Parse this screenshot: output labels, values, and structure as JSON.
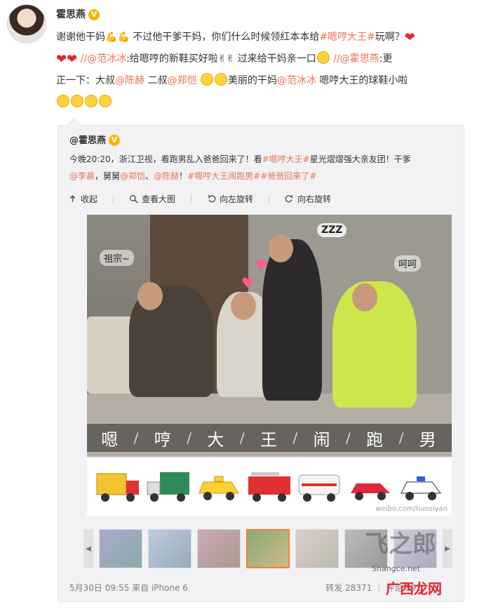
{
  "header": {
    "username": "霍思燕",
    "vip_badge": "V"
  },
  "post": {
    "line1_a": "谢谢他干妈",
    "line1_b": "不过他干爹干妈，你们什么时候领红本本给",
    "tag_hengheng": "#嗯哼大王#",
    "line1_c": "玩啊？",
    "mention_fbb_1": "//@范冰冰",
    "line2_a": ":给嗯哼的新鞋买好啦",
    "line2_b": "过来给干妈亲一口",
    "mention_hsy": "//@霍思燕",
    "line2_c": ":更",
    "line3_a": "正一下：大叔",
    "mention_chenhe": "@陈赫",
    "line3_b": "二叔",
    "mention_zhengkai": "@郑恺",
    "line3_c": "美丽的干妈",
    "mention_fbb_2": "@范冰冰",
    "line3_d": "嗯哼大王的球鞋小啦"
  },
  "repost": {
    "username": "@霍思燕",
    "vip_badge": "V",
    "text_a": "今晚20:20，浙江卫视，看跑男乱入爸爸回来了！看",
    "tag1": "#嗯哼大王#",
    "text_b": "星光熠熠强大亲友团！干爹",
    "mention_lichen": "@李晨",
    "text_c": "，舅舅",
    "mention_zhengkai": "@郑恺",
    "text_d": "、",
    "mention_chenhe": "@陈赫",
    "text_e": "！",
    "tag2": "#嗯哼大王闹跑男#",
    "tag3": "#爸爸回来了#",
    "toolbar": {
      "collect": "收起",
      "view_large": "查看大图",
      "rotate_left": "向左旋转",
      "rotate_right": "向右旋转"
    },
    "photo": {
      "label_left": "祖宗~",
      "label_right": "呵呵",
      "label_sleep": "ZZZ",
      "banner_chars": [
        "嗯",
        "哼",
        "大",
        "王",
        "闹",
        "跑",
        "男"
      ],
      "watermark": "weibo.com/huosiyan"
    },
    "meta": {
      "date": "5月30日 09:55",
      "source": "来自 iPhone 6"
    },
    "stats": {
      "repost_label": "转发 28371",
      "comment_label": "评论 391"
    }
  },
  "site_watermark": {
    "big": "飞之郎",
    "small": "Shangce.net",
    "brand": "广西龙网"
  },
  "colors": {
    "link": "#eb7350",
    "badge": "#f7b500",
    "active_thumb": "#fa7d3c"
  }
}
